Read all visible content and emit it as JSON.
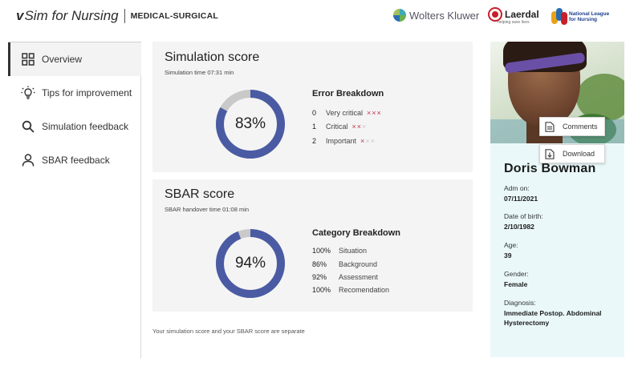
{
  "header": {
    "brand_v": "v",
    "brand_sim": "Sim for Nursing",
    "brand_sub": "MEDICAL-SURGICAL",
    "logos": {
      "wolters_kluwer": "Wolters Kluwer",
      "laerdal": "Laerdal",
      "laerdal_tagline": "helping save lives",
      "nln": "National League for Nursing"
    }
  },
  "sidebar": {
    "items": [
      {
        "label": "Overview",
        "icon": "grid-icon",
        "active": true
      },
      {
        "label": "Tips for improvement",
        "icon": "lightbulb-icon",
        "active": false
      },
      {
        "label": "Simulation feedback",
        "icon": "search-icon",
        "active": false
      },
      {
        "label": "SBAR feedback",
        "icon": "person-icon",
        "active": false
      }
    ]
  },
  "simulation": {
    "title": "Simulation score",
    "subtitle": "Simulation time 07:31 min",
    "score_label": "83%",
    "score_fraction": 0.83,
    "breakdown_title": "Error Breakdown",
    "rows": [
      {
        "count": "0",
        "label": "Very critical",
        "red": 3,
        "gray": 0
      },
      {
        "count": "1",
        "label": "Critical",
        "red": 2,
        "gray": 1
      },
      {
        "count": "2",
        "label": "Important",
        "red": 1,
        "gray": 2
      }
    ]
  },
  "sbar": {
    "title": "SBAR score",
    "subtitle": "SBAR handover time 01:08 min",
    "score_label": "94%",
    "score_fraction": 0.94,
    "breakdown_title": "Category Breakdown",
    "rows": [
      {
        "pct": "100%",
        "label": "Situation"
      },
      {
        "pct": "86%",
        "label": "Background"
      },
      {
        "pct": "92%",
        "label": "Assessment"
      },
      {
        "pct": "100%",
        "label": "Recomendation"
      }
    ]
  },
  "footnote": "Your simulation score and your SBAR score are separate",
  "patient": {
    "buttons": {
      "comments": "Comments",
      "download": "Download"
    },
    "name": "Doris Bowman",
    "fields": [
      {
        "label": "Adm on:",
        "value": "07/11/2021"
      },
      {
        "label": "Date of birth:",
        "value": "2/10/1982"
      },
      {
        "label": "Age:",
        "value": "39"
      },
      {
        "label": "Gender:",
        "value": "Female"
      },
      {
        "label": "Diagnosis:",
        "value": "Immediate Postop. Abdominal Hysterectomy"
      }
    ]
  },
  "colors": {
    "donut_fill": "#4a5ba3",
    "donut_track": "#c9c9c9",
    "error_mark": "#c0354a",
    "patient_panel": "#eaf8fa",
    "card_bg": "#f4f4f4"
  }
}
